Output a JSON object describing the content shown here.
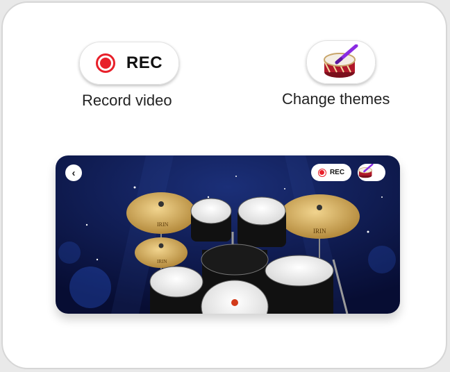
{
  "controls": {
    "rec_label": "REC",
    "rec_caption": "Record video",
    "theme_caption": "Change themes"
  },
  "preview": {
    "back_glyph": "‹",
    "rec_label": "REC",
    "cymbal_brand": "IRIN"
  },
  "colors": {
    "accent_red": "#e8202a",
    "drum_red": "#b0182a",
    "stick_purple": "#8a2be2",
    "stage_dark": "#0d1646",
    "cymbal_gold": "#d4b064"
  }
}
